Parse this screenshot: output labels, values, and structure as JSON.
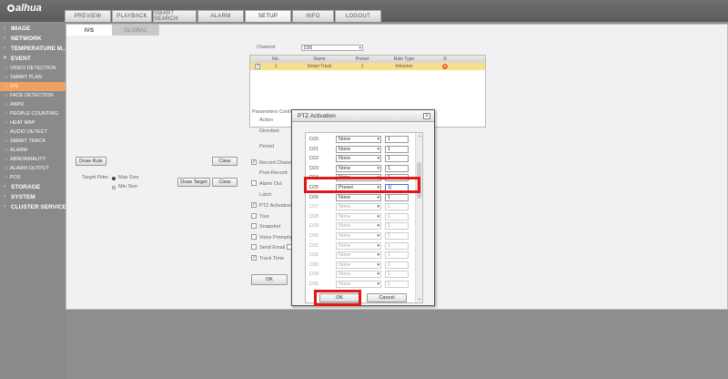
{
  "brand": {
    "logo": "alhua"
  },
  "nav": [
    "PREVIEW",
    "PLAYBACK",
    "SMART SEARCH",
    "ALARM",
    "SETUP",
    "INFO",
    "LOGOUT"
  ],
  "sidebar": [
    {
      "label": "IMAGE",
      "level": "top"
    },
    {
      "label": "NETWORK",
      "level": "top"
    },
    {
      "label": "TEMPERATURE M...",
      "level": "top"
    },
    {
      "label": "EVENT",
      "level": "top-open"
    },
    {
      "label": "VIDEO DETECTION",
      "level": "sub"
    },
    {
      "label": "SMART PLAN",
      "level": "sub"
    },
    {
      "label": "IVS",
      "level": "sub",
      "active": true
    },
    {
      "label": "FACE DETECTION",
      "level": "sub"
    },
    {
      "label": "ANPR",
      "level": "sub"
    },
    {
      "label": "PEOPLE COUNTING",
      "level": "sub"
    },
    {
      "label": "HEAT MAP",
      "level": "sub"
    },
    {
      "label": "AUDIO DETECT",
      "level": "sub"
    },
    {
      "label": "SMART TRACK",
      "level": "sub"
    },
    {
      "label": "ALARM",
      "level": "sub"
    },
    {
      "label": "ABNORMALITY",
      "level": "sub"
    },
    {
      "label": "ALARM OUTPUT",
      "level": "sub"
    },
    {
      "label": "POS",
      "level": "sub"
    },
    {
      "label": "STORAGE",
      "level": "top"
    },
    {
      "label": "SYSTEM",
      "level": "top"
    },
    {
      "label": "CLUSTER SERVICE",
      "level": "top"
    }
  ],
  "subtabs": [
    "IVS",
    "GLOBAL"
  ],
  "channel": {
    "label": "Channel",
    "value": "D26"
  },
  "rules_table": {
    "headers": [
      "",
      "No.",
      "Name",
      "Preset",
      "Rule Type",
      ""
    ],
    "row": {
      "no": "1",
      "name": "Smart Track",
      "preset": "1",
      "rule_type": "Intrusion"
    }
  },
  "params": {
    "title": "Parameters Config",
    "action": "Action",
    "direction": "Direction",
    "period": "Period",
    "record_channel": "Record Channel",
    "post_record": "Post-Record",
    "alarm_out": "Alarm Out",
    "latch": "Latch",
    "ptz_activation": "PTZ Activation",
    "tour": "Tour",
    "snapshot": "Snapshot",
    "voice_prompts": "Voice Prompts",
    "send_email": "Send Email",
    "track_time": "Track Time"
  },
  "left_panel": {
    "draw_rule": "Draw Rule",
    "clear": "Clear",
    "target_filter": "Target Filter",
    "max_size": "Max Size",
    "min_size": "Min Size",
    "draw_target": "Draw Target"
  },
  "footer": {
    "ok": "OK"
  },
  "dialog": {
    "title": "PTZ Activation",
    "close": "×",
    "ok": "OK",
    "cancel": "Cancel",
    "rows": [
      {
        "ch": "D20",
        "type": "None",
        "num": "1",
        "enabled": true
      },
      {
        "ch": "D21",
        "type": "None",
        "num": "1",
        "enabled": true
      },
      {
        "ch": "D22",
        "type": "None",
        "num": "1",
        "enabled": true
      },
      {
        "ch": "D23",
        "type": "None",
        "num": "1",
        "enabled": true
      },
      {
        "ch": "D24",
        "type": "None",
        "num": "1",
        "enabled": true
      },
      {
        "ch": "D25",
        "type": "Preset",
        "num": "1|",
        "enabled": true,
        "focus": true
      },
      {
        "ch": "D26",
        "type": "None",
        "num": "1",
        "enabled": true
      },
      {
        "ch": "D27",
        "type": "None",
        "num": "1",
        "enabled": false
      },
      {
        "ch": "D28",
        "type": "None",
        "num": "1",
        "enabled": false
      },
      {
        "ch": "D29",
        "type": "None",
        "num": "1",
        "enabled": false
      },
      {
        "ch": "D30",
        "type": "None",
        "num": "1",
        "enabled": false
      },
      {
        "ch": "D31",
        "type": "None",
        "num": "1",
        "enabled": false
      },
      {
        "ch": "D32",
        "type": "None",
        "num": "1",
        "enabled": false
      },
      {
        "ch": "D33",
        "type": "None",
        "num": "1",
        "enabled": false
      },
      {
        "ch": "D34",
        "type": "None",
        "num": "1",
        "enabled": false
      },
      {
        "ch": "D35",
        "type": "None",
        "num": "1",
        "enabled": false
      }
    ]
  },
  "colors": {
    "highlight": "#e01818",
    "active_sidebar": "#f0a060",
    "selected_row": "#f6e08c"
  }
}
